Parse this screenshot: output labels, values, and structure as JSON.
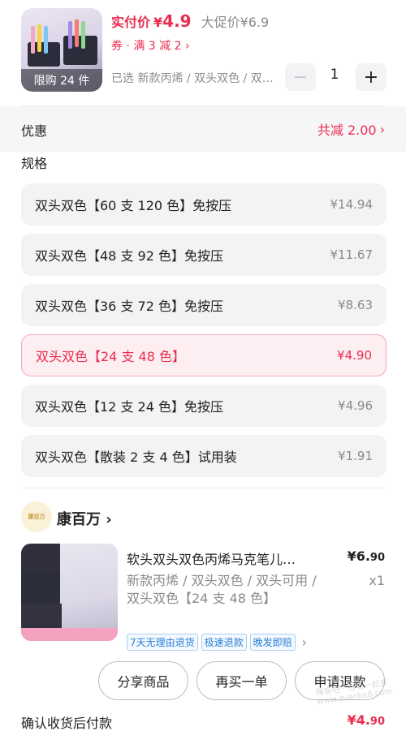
{
  "product": {
    "limit_badge": "限购 24 件",
    "price_label": "实付价",
    "price_symbol": "¥",
    "price_value": "4.9",
    "promo_price": "大促价¥6.9",
    "coupon": "券 · 满 3 减 2 ›",
    "selected": "已选 新款丙烯 / 双头双色 / 双…",
    "quantity": "1",
    "minus": "−",
    "plus": "+"
  },
  "discount": {
    "label": "优惠",
    "value": "共减 2.00",
    "arrow": "›"
  },
  "spec": {
    "title": "规格",
    "options": [
      {
        "name": "双头双色【60 支 120 色】免按压",
        "price": "¥14.94",
        "selected": false
      },
      {
        "name": "双头双色【48 支 92 色】免按压",
        "price": "¥11.67",
        "selected": false
      },
      {
        "name": "双头双色【36 支 72 色】免按压",
        "price": "¥8.63",
        "selected": false
      },
      {
        "name": "双头双色【24 支 48 色】",
        "price": "¥4.90",
        "selected": true
      },
      {
        "name": "双头双色【12 支 24 色】免按压",
        "price": "¥4.96",
        "selected": false
      },
      {
        "name": "双头双色【散装 2 支 4 色】试用装",
        "price": "¥1.91",
        "selected": false
      }
    ]
  },
  "shop": {
    "logo_text": "康百万",
    "name": "康百万 ›"
  },
  "order_item": {
    "title": "软头双头双色丙烯马克笔儿…",
    "price_main": "¥6.",
    "price_small": "90",
    "variant": "新款丙烯 / 双头双色 / 双头可用 / 双头双色【24 支 48 色】",
    "quantity": "x1",
    "tags": [
      "7天无理由退货",
      "极速退款",
      "晚发即赔"
    ],
    "tags_arrow": "›"
  },
  "actions": {
    "share": "分享商品",
    "rebuy": "再买一单",
    "refund": "申请退款"
  },
  "footer": {
    "label": "确认收货后付款",
    "price_main": "¥4.",
    "price_small": "90"
  },
  "watermark": "赚客吧 · 有奖一起享 www.zuanke8.com",
  "colors": {
    "accent": "#ea2d4f",
    "muted": "#8a8a8a",
    "tag_blue": "#2a7fd6"
  }
}
